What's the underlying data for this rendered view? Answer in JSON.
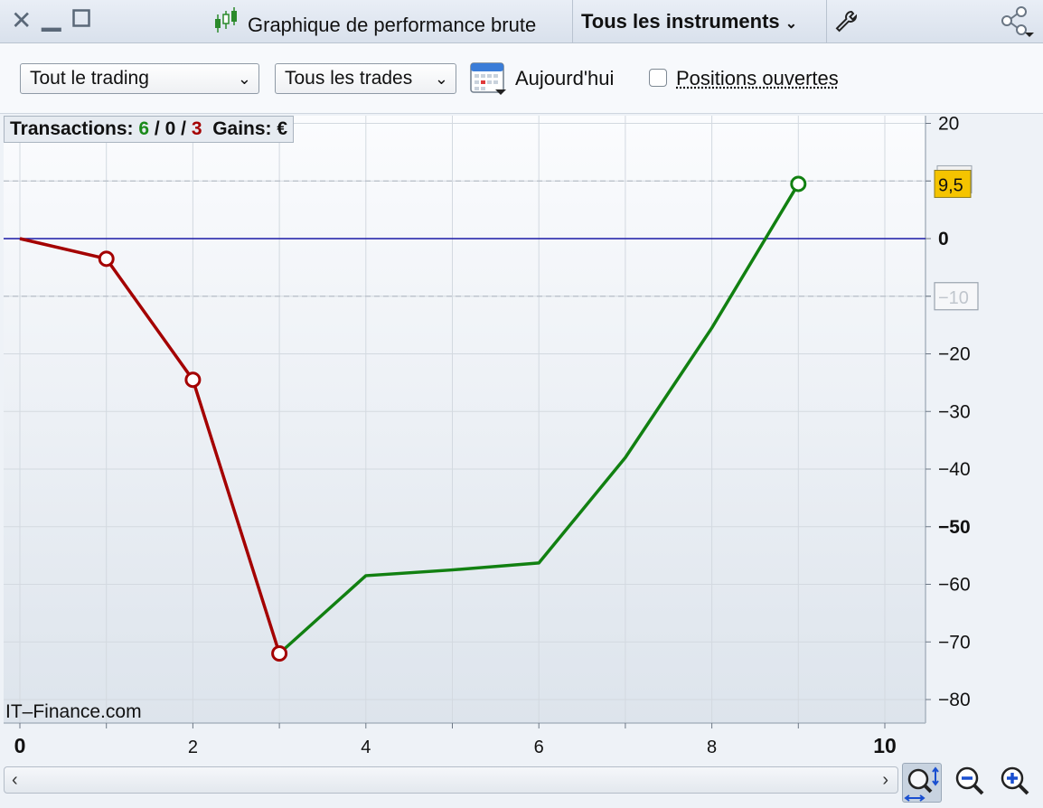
{
  "titlebar": {
    "title": "Graphique de performance brute",
    "instruments": "Tous les instruments"
  },
  "toolbar": {
    "trading_select": "Tout le trading",
    "trades_select": "Tous les trades",
    "today_label": "Aujourd'hui",
    "open_positions_label": "Positions ouvertes",
    "open_positions_checked": false
  },
  "stats": {
    "transactions_label": "Transactions:",
    "wins": "6",
    "sep1": "/",
    "even": "0",
    "sep2": "/",
    "losses": "3",
    "gains_label": "Gains: €"
  },
  "watermark": "IT–Finance.com",
  "colors": {
    "loss_line": "#a40000",
    "gain_line": "#118011",
    "zero_line": "#1a1aa6",
    "marker_bg": "#f5c400"
  },
  "chart_data": {
    "type": "line",
    "xlim": [
      0,
      10.5
    ],
    "ylim": [
      -82,
      22
    ],
    "x_ticks": [
      0,
      2,
      4,
      6,
      8,
      10
    ],
    "x_tick_labels": [
      "0",
      "2",
      "4",
      "6",
      "8",
      "10"
    ],
    "x_bold_ticks": [
      0,
      10
    ],
    "y_ticks": [
      20,
      0,
      -20,
      -30,
      -40,
      -50,
      -60,
      -70,
      -80
    ],
    "y_tick_labels": [
      "20",
      "0",
      "−20",
      "−30",
      "−40",
      "−50",
      "−60",
      "−70",
      "−80"
    ],
    "y_bold_ticks": [
      0,
      -50
    ],
    "y_minor_ticks": [
      10,
      -10
    ],
    "series": [
      {
        "x": [
          0,
          1,
          2,
          3
        ],
        "y": [
          0,
          -3.5,
          -24.5,
          -72
        ],
        "color": "loss",
        "markers_at": [
          1,
          2,
          3
        ]
      },
      {
        "x": [
          3,
          4,
          5,
          6,
          7,
          8,
          9
        ],
        "y": [
          -72,
          -58.5,
          -57.5,
          -56.3,
          -38,
          -15.5,
          9.5
        ],
        "color": "gain",
        "markers_at": [
          9
        ]
      }
    ],
    "reference_lines": [
      10,
      -10
    ],
    "zero_line": 0,
    "markers": [
      {
        "label": "9,5",
        "value": 9.5,
        "style": "highlight"
      },
      {
        "label": "−10",
        "value": -10,
        "style": "plain"
      }
    ]
  }
}
